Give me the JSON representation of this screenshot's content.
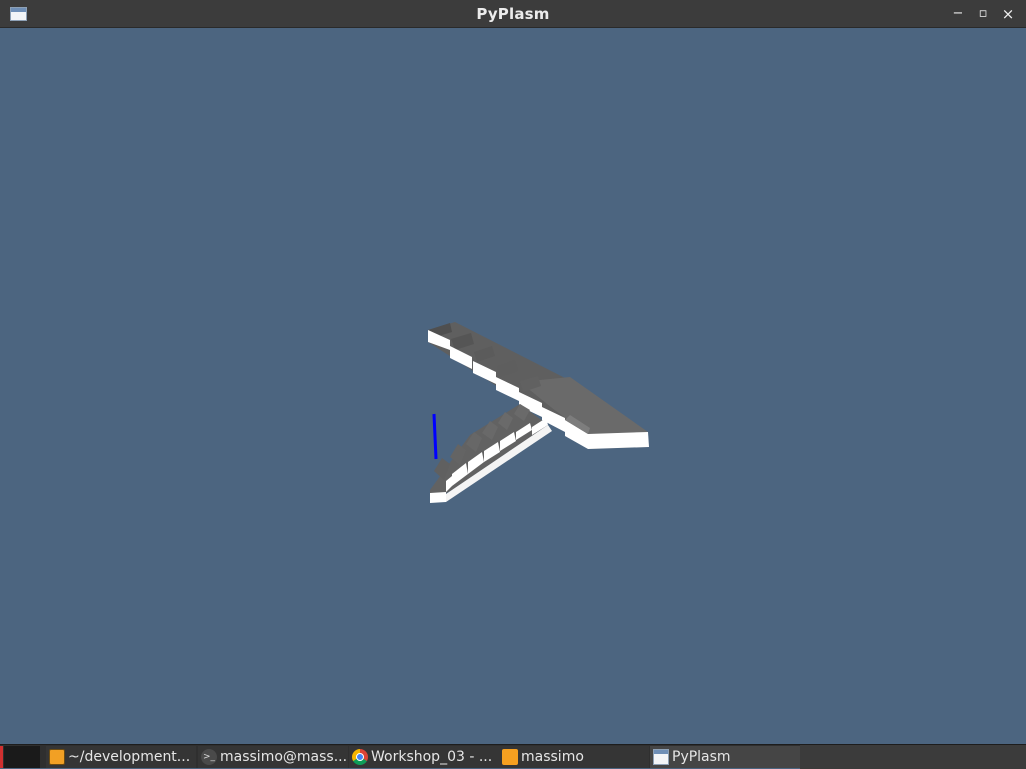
{
  "window": {
    "title": "PyPlasm",
    "controls": {
      "minimize": "−",
      "maximize": "▫",
      "close": "×"
    }
  },
  "colors": {
    "viewport_background": "#4c6580",
    "step_top": "#5f5f5f",
    "step_front": "#ffffff",
    "step_side": "#8a8a8a",
    "axis_marker": "#0000ff"
  },
  "taskbar": {
    "tasks": [
      {
        "label": "~/development...",
        "icon": "sublime-text-icon"
      },
      {
        "label": "massimo@mass...",
        "icon": "terminal-icon"
      },
      {
        "label": "Workshop_03 - ...",
        "icon": "chrome-icon"
      },
      {
        "label": "massimo",
        "icon": "folder-icon"
      },
      {
        "label": "PyPlasm",
        "icon": "window-icon",
        "active": true
      }
    ]
  }
}
